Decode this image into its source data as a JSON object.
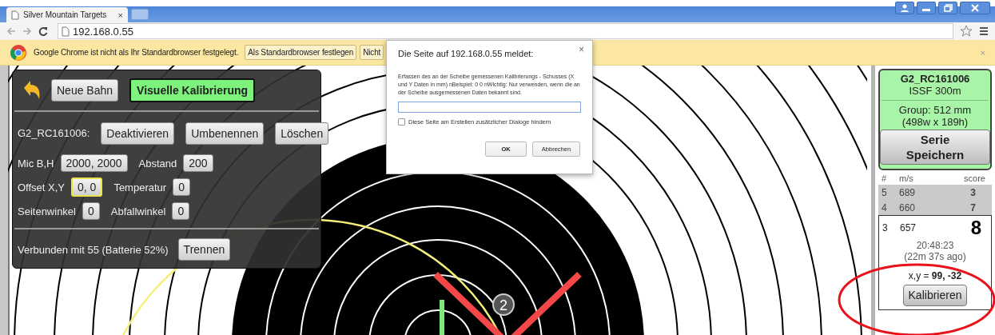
{
  "browser": {
    "tab_title": "Silver Mountain Targets",
    "tab_close": "×",
    "address": "192.168.0.55"
  },
  "infobar": {
    "message": "Google Chrome ist nicht als Ihr Standardbrowser festgelegt.",
    "buttons": [
      "Als Standardbrowser festlegen",
      "Nicht"
    ],
    "close": "×"
  },
  "control_panel": {
    "mode_buttons": [
      {
        "label": "Neue Bahn",
        "selected": false
      },
      {
        "label": "Visuelle Kalibrierung",
        "selected": true
      }
    ],
    "device_label": "G2_RC161006:",
    "device_buttons": [
      "Deaktivieren",
      "Umbenennen",
      "Löschen"
    ],
    "settings_rows": [
      [
        {
          "label": "Mic B,H",
          "value": "2000, 2000",
          "focused": false
        },
        {
          "label": "Abstand",
          "value": "200",
          "focused": false
        }
      ],
      [
        {
          "label": "Offset X,Y",
          "value": "0, 0",
          "focused": true
        },
        {
          "label": "Temperatur",
          "value": "0",
          "focused": false
        }
      ],
      [
        {
          "label": "Seitenwinkel",
          "value": "0",
          "focused": false
        },
        {
          "label": "Abfallwinkel",
          "value": "0",
          "focused": false
        }
      ]
    ],
    "status": "Verbunden mit 55 (Batterie 52%)",
    "disconnect_button": "Trennen"
  },
  "target": {
    "shot_marker": "2"
  },
  "dialog": {
    "title": "Die Seite auf 192.168.0.55 meldet:",
    "close": "×",
    "message": "Erfassen des an der Scheibe gemessenen  Kalibrierungs - Schusses  (X und Y Daten in mm)  nBeispiel: 0 0  nWichtig: Nur verwenden, wenn die an der Scheibe ausgemessenen Daten bekannt sind.",
    "checkbox": {
      "label": "Diese Seite am Erstellen zusätzlicher Dialoge hindern",
      "checked": false
    },
    "buttons": [
      "OK",
      "Abbrechen"
    ]
  },
  "side_panel": {
    "name": "G2_RC161006",
    "discipline": "ISSF 300m",
    "group": "Group: 512 mm",
    "group_size": "(498w x 189h)",
    "save_button": "Serie Speichern",
    "columns": [
      "#",
      "m/s",
      "score"
    ],
    "shots": [
      {
        "number": "5",
        "speed": "689",
        "score": "3",
        "selected": false
      },
      {
        "number": "4",
        "speed": "660",
        "score": "7",
        "selected": false
      },
      {
        "number": "3",
        "speed": "657",
        "score": "8",
        "selected": true,
        "time": "20:48:23",
        "ago": "(22m 37s ago)",
        "coords": "x,y = **99, -32**",
        "button": "Kalibrieren"
      }
    ]
  }
}
